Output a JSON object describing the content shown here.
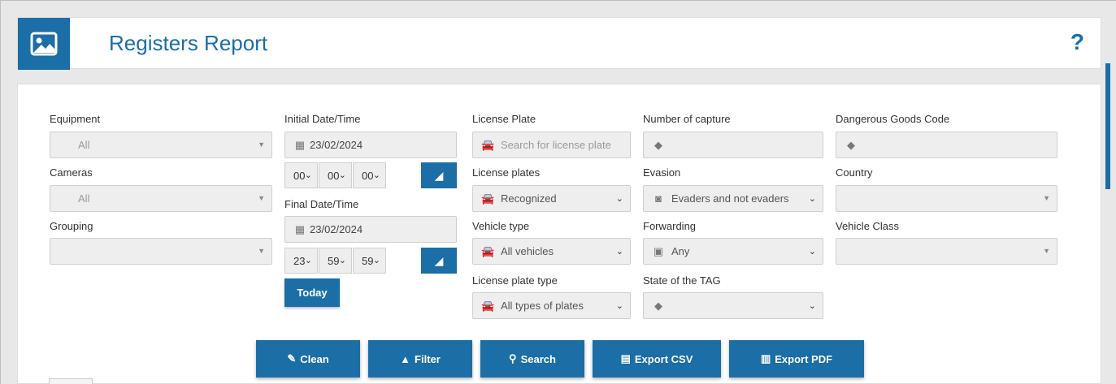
{
  "header": {
    "title": "Registers Report",
    "help": "?"
  },
  "filters": {
    "equipment": {
      "label": "Equipment",
      "value": "All"
    },
    "cameras": {
      "label": "Cameras",
      "value": "All"
    },
    "grouping": {
      "label": "Grouping",
      "value": ""
    },
    "initial": {
      "label": "Initial Date/Time",
      "date": "23/02/2024",
      "hh": "00",
      "mm": "00",
      "ss": "00"
    },
    "final": {
      "label": "Final Date/Time",
      "date": "23/02/2024",
      "hh": "23",
      "mm": "59",
      "ss": "59"
    },
    "today_label": "Today",
    "license_plate": {
      "label": "License Plate",
      "placeholder": "Search for license plate"
    },
    "license_plates": {
      "label": "License plates",
      "value": "Recognized"
    },
    "vehicle_type": {
      "label": "Vehicle type",
      "value": "All vehicles"
    },
    "license_plate_type": {
      "label": "License plate type",
      "value": "All types of plates"
    },
    "number_of_capture": {
      "label": "Number of capture",
      "value": ""
    },
    "evasion": {
      "label": "Evasion",
      "value": "Evaders and not evaders"
    },
    "forwarding": {
      "label": "Forwarding",
      "value": "Any"
    },
    "tag_state": {
      "label": "State of the TAG",
      "value": ""
    },
    "dangerous_goods": {
      "label": "Dangerous Goods Code",
      "value": ""
    },
    "country": {
      "label": "Country",
      "value": ""
    },
    "vehicle_class": {
      "label": "Vehicle Class",
      "value": ""
    }
  },
  "actions": {
    "clean": "Clean",
    "filter": "Filter",
    "search": "Search",
    "export_csv": "Export CSV",
    "export_pdf": "Export PDF"
  },
  "icons": {
    "logo": "image-icon",
    "calendar": "calendar-icon",
    "car": "car-icon",
    "tag": "tag-icon",
    "camera": "camera-icon",
    "picture": "picture-icon",
    "eraser": "eraser-icon"
  },
  "colors": {
    "accent": "#1b6ea6"
  }
}
